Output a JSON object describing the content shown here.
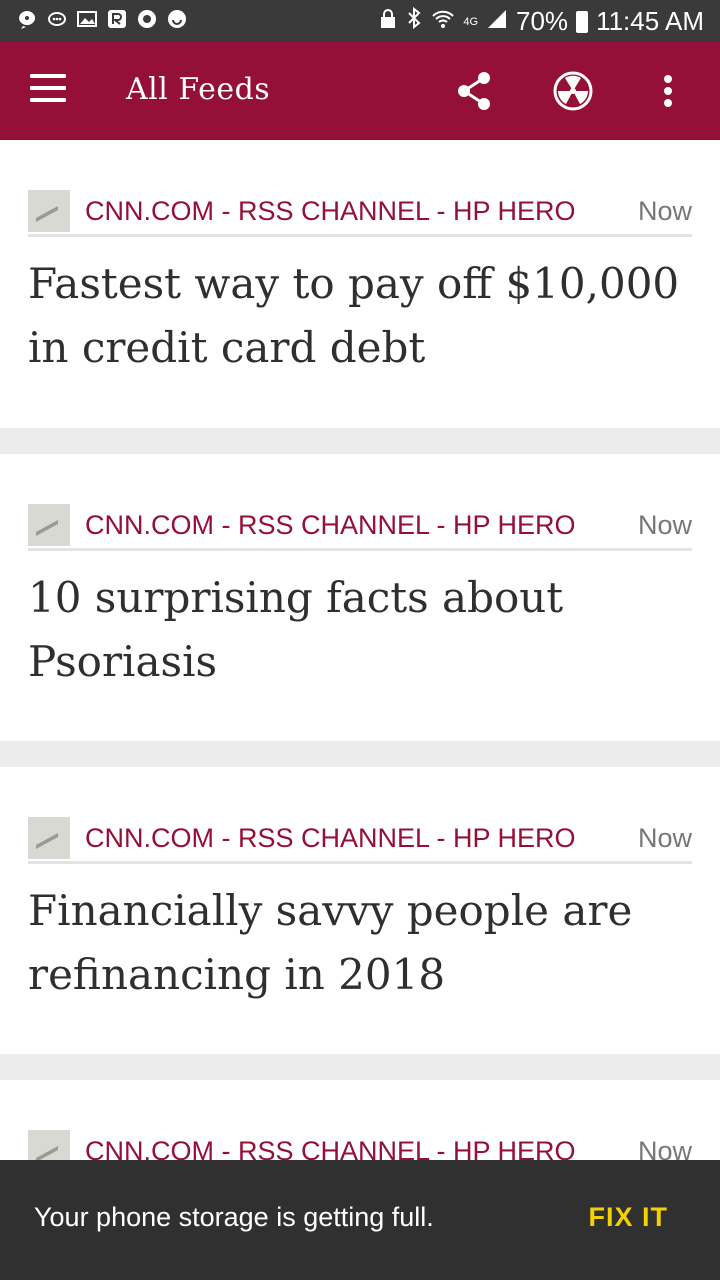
{
  "status_bar": {
    "battery": "70%",
    "time": "11:45 AM",
    "network": "4G",
    "icons": [
      "message-icon",
      "bubble-icon",
      "image-icon",
      "r-app-icon",
      "circle-app-icon",
      "emoji-icon",
      "lock-icon",
      "bluetooth-icon",
      "wifi-icon",
      "signal-icon",
      "battery-icon"
    ]
  },
  "app_bar": {
    "title": "All Feeds",
    "background": "#951038",
    "icons": [
      "menu-icon",
      "share-icon",
      "radiation-icon",
      "more-vert-icon"
    ]
  },
  "feed_items": [
    {
      "source": "CNN.COM - RSS CHANNEL - HP HERO",
      "time": "Now",
      "headline": "Fastest way to pay off $10,000 in credit card debt"
    },
    {
      "source": "CNN.COM - RSS CHANNEL - HP HERO",
      "time": "Now",
      "headline": "10 surprising facts about Psoriasis"
    },
    {
      "source": "CNN.COM - RSS CHANNEL - HP HERO",
      "time": "Now",
      "headline": "Financially savvy people are refinancing in 2018"
    },
    {
      "source": "CNN.COM - RSS CHANNEL - HP HERO",
      "time": "Now",
      "headline": ""
    }
  ],
  "snackbar": {
    "message": "Your phone storage is getting full.",
    "action": "FIX IT",
    "action_color": "#f5d000"
  }
}
